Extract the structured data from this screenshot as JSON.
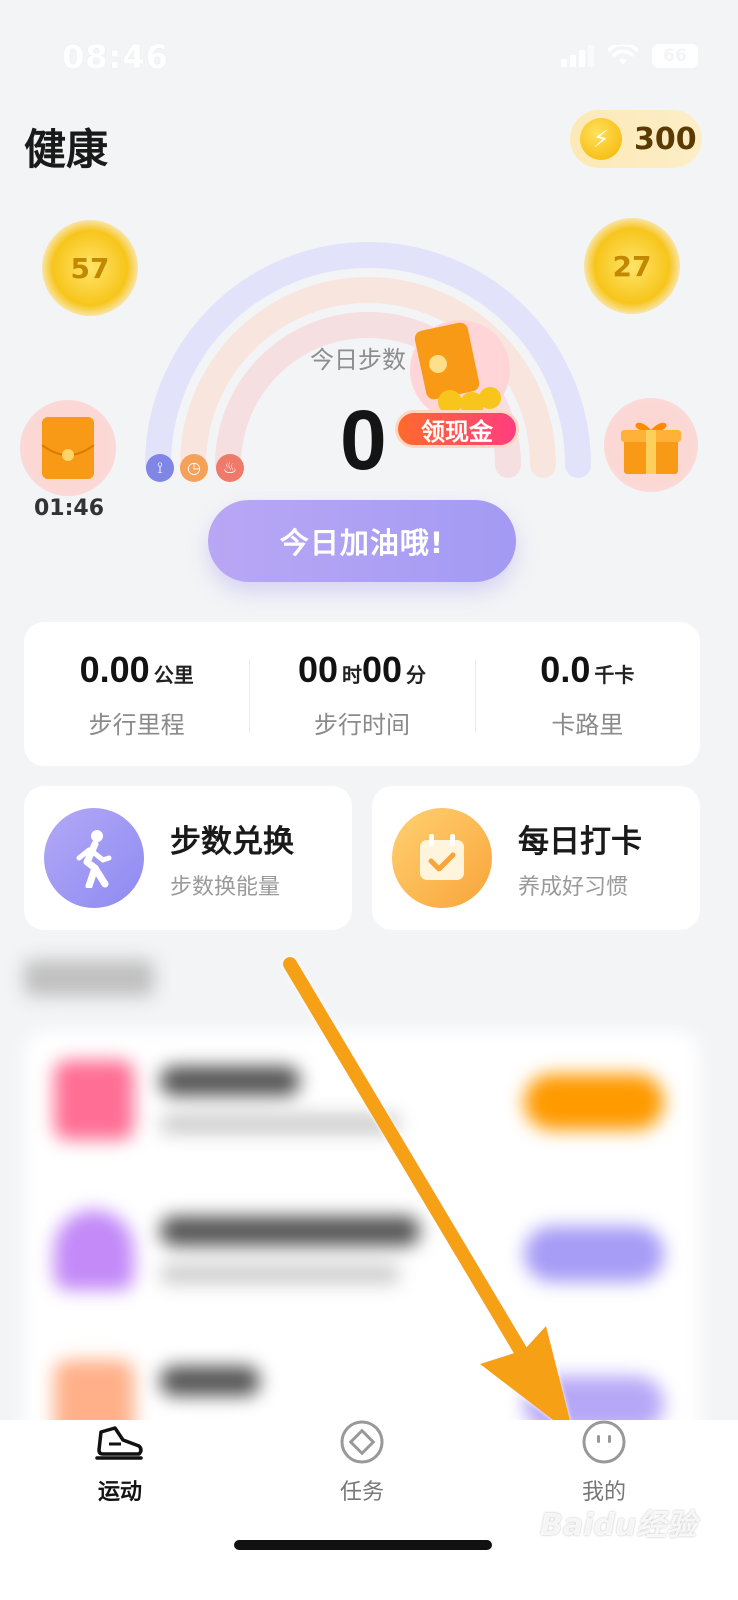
{
  "status_bar": {
    "time": "08:46",
    "battery": "66"
  },
  "header": {
    "title": "健康",
    "coins": "300"
  },
  "bubbles": {
    "left_coin": "57",
    "right_coin": "27",
    "timer": "01:46"
  },
  "promo": {
    "label": "领现金"
  },
  "steps": {
    "label": "今日步数",
    "value": "0"
  },
  "cta": {
    "label": "今日加油哦!"
  },
  "stats": [
    {
      "value": "0.00",
      "unit": "公里",
      "label": "步行里程"
    },
    {
      "value_h": "00",
      "unit_h": "时",
      "value_m": "00",
      "unit_m": "分",
      "label": "步行时间"
    },
    {
      "value": "0.0",
      "unit": "千卡",
      "label": "卡路里"
    }
  ],
  "features": [
    {
      "title": "步数兑换",
      "subtitle": "步数换能量",
      "icon": "walking-person-icon",
      "color": "#9d95f4"
    },
    {
      "title": "每日打卡",
      "subtitle": "养成好习惯",
      "icon": "calendar-check-icon",
      "color": "#fbb24a"
    }
  ],
  "tabs": [
    {
      "label": "运动",
      "icon": "sneaker-icon",
      "active": true
    },
    {
      "label": "任务",
      "icon": "diamond-task-icon",
      "active": false
    },
    {
      "label": "我的",
      "icon": "smiley-face-icon",
      "active": false
    }
  ],
  "watermark": "Baidu经验",
  "colors": {
    "accent": "#a39af3",
    "arrow": "#f6a019",
    "background": "#f3f4f6"
  }
}
